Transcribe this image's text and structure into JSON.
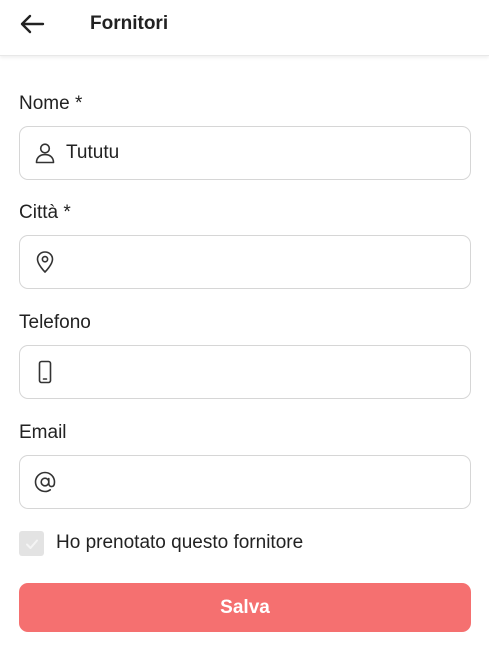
{
  "header": {
    "back_icon": "arrow-left-icon",
    "title": "Fornitori"
  },
  "form": {
    "name": {
      "label": "Nome *",
      "value": "Tututu",
      "icon": "user-icon"
    },
    "city": {
      "label": "Città *",
      "value": "",
      "icon": "map-pin-icon"
    },
    "phone": {
      "label": "Telefono",
      "value": "",
      "icon": "smartphone-icon"
    },
    "email": {
      "label": "Email",
      "value": "",
      "icon": "at-sign-icon"
    },
    "booked": {
      "label": "Ho prenotato questo fornitore",
      "checked": false
    }
  },
  "actions": {
    "save_label": "Salva"
  },
  "colors": {
    "accent": "#f57070",
    "border": "#d6d6d6",
    "checkbox_bg": "#e3e3e3",
    "text": "#222222"
  }
}
